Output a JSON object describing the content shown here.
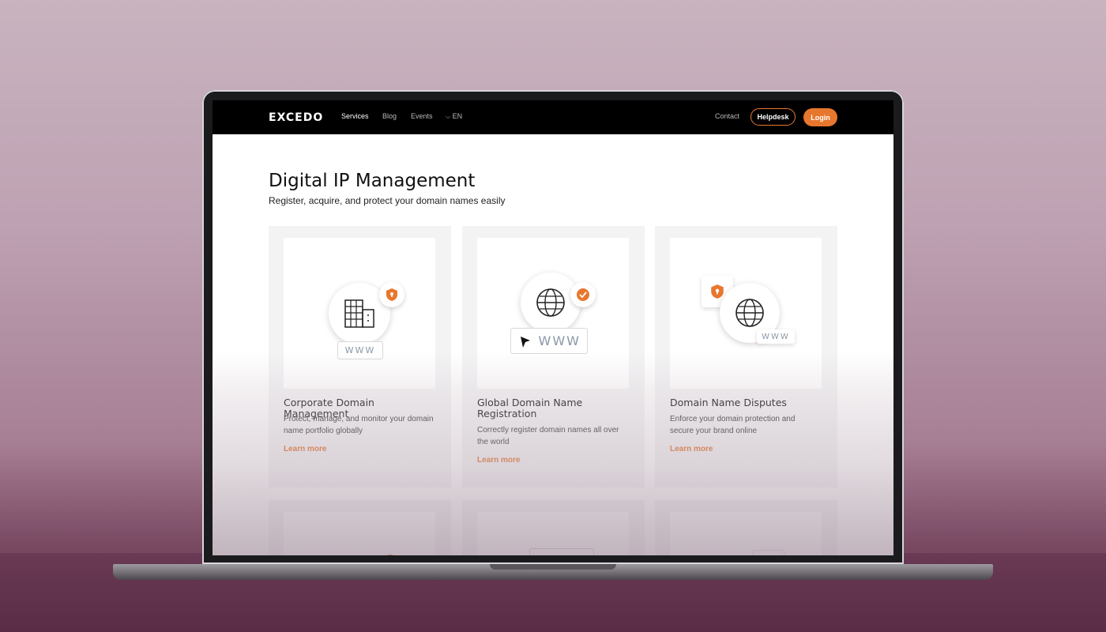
{
  "nav": {
    "logo": "EXCEDO",
    "links": [
      "Services",
      "Blog",
      "Events"
    ],
    "language": "EN",
    "contact": "Contact",
    "helpdesk": "Helpdesk",
    "login": "Login"
  },
  "hero": {
    "title": "Digital IP Management",
    "subtitle": "Register, acquire, and protect your domain names easily"
  },
  "cards": [
    {
      "title": "Corporate Domain Management",
      "description": "Protect, manage, and monitor your domain name portfolio globally",
      "link": "Learn more",
      "www": "WWW"
    },
    {
      "title": "Global Domain Name Registration",
      "description": "Correctly register domain names all over the world",
      "link": "Learn more",
      "www": "WWW"
    },
    {
      "title": "Domain Name Disputes",
      "description": "Enforce your domain protection and secure your brand online",
      "link": "Learn more",
      "www": "WWW"
    }
  ],
  "colors": {
    "accent": "#e8772e",
    "nav_bg": "#000000"
  }
}
